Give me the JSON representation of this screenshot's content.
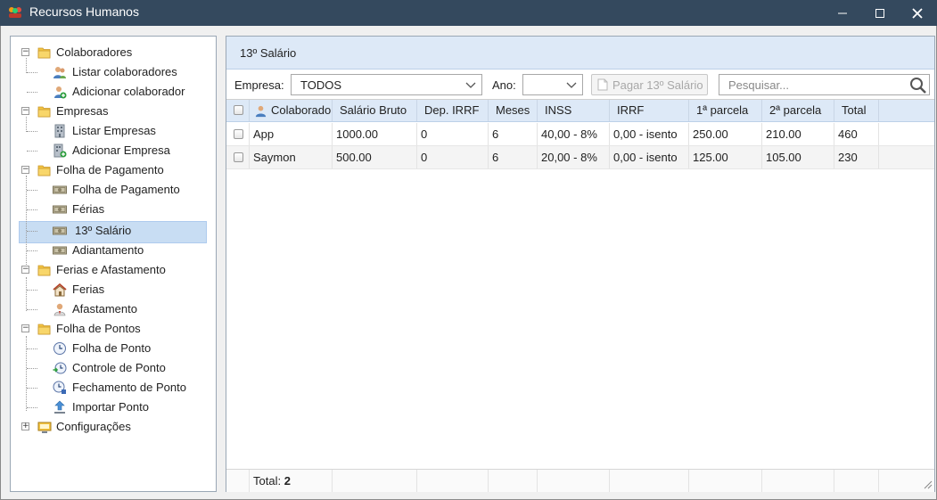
{
  "window": {
    "title": "Recursos Humanos",
    "controls": {
      "minimize": "—",
      "maximize": "☐",
      "close": "✕"
    }
  },
  "sidebar": {
    "groups": [
      {
        "label": "Colaboradores",
        "expander": "−",
        "items": [
          {
            "label": "Listar colaboradores",
            "icon": "users-icon"
          },
          {
            "label": "Adicionar colaborador",
            "icon": "add-user-icon"
          }
        ]
      },
      {
        "label": "Empresas",
        "expander": "−",
        "items": [
          {
            "label": "Listar Empresas",
            "icon": "building-icon"
          },
          {
            "label": "Adicionar Empresa",
            "icon": "add-building-icon"
          }
        ]
      },
      {
        "label": "Folha de Pagamento",
        "expander": "−",
        "items": [
          {
            "label": "Folha de Pagamento",
            "icon": "money-icon"
          },
          {
            "label": "Férias",
            "icon": "money-icon"
          },
          {
            "label": "13º Salário",
            "icon": "money-icon",
            "selected": true
          },
          {
            "label": "Adiantamento",
            "icon": "money-icon"
          }
        ]
      },
      {
        "label": "Ferias e Afastamento",
        "expander": "−",
        "items": [
          {
            "label": "Ferias",
            "icon": "house-icon"
          },
          {
            "label": "Afastamento",
            "icon": "person-icon"
          }
        ]
      },
      {
        "label": "Folha de Pontos",
        "expander": "−",
        "items": [
          {
            "label": "Folha de Ponto",
            "icon": "clock-icon"
          },
          {
            "label": "Controle de Ponto",
            "icon": "clock-arrow-icon"
          },
          {
            "label": "Fechamento de Ponto",
            "icon": "clock-lock-icon"
          },
          {
            "label": "Importar Ponto",
            "icon": "upload-icon"
          }
        ]
      },
      {
        "label": "Configurações",
        "expander": "+",
        "items": []
      }
    ]
  },
  "main": {
    "title": "13º Salário",
    "toolbar": {
      "empresa_label": "Empresa:",
      "empresa_value": "TODOS",
      "ano_label": "Ano:",
      "ano_value": "",
      "pay_button": "Pagar 13º Salário",
      "search_placeholder": "Pesquisar..."
    },
    "table": {
      "columns": [
        "Colaborador",
        "Salário Bruto",
        "Dep. IRRF",
        "Meses",
        "INSS",
        "IRRF",
        "1ª parcela",
        "2ª parcela",
        "Total"
      ],
      "rows": [
        [
          "App",
          "1000.00",
          "0",
          "6",
          "40,00 - 8%",
          "0,00 - isento",
          "250.00",
          "210.00",
          "460"
        ],
        [
          "Saymon",
          "500.00",
          "0",
          "6",
          "20,00 - 8%",
          "0,00 - isento",
          "125.00",
          "105.00",
          "230"
        ]
      ]
    },
    "footer": {
      "total_label": "Total:",
      "total_value": "2"
    }
  },
  "colors": {
    "titlebar": "#34495e",
    "header_bg": "#dde9f7",
    "selection": "#c8ddf3",
    "folder": "#f4c542"
  }
}
